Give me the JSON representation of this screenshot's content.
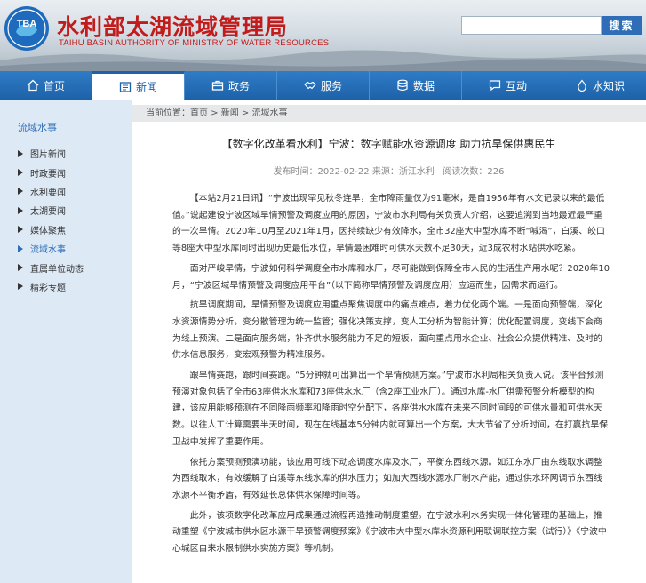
{
  "header": {
    "logo_text": "TBA",
    "title": "水利部太湖流域管理局",
    "subtitle": "TAIHU BASIN AUTHORITY OF MINISTRY OF WATER RESOURCES",
    "search": {
      "placeholder": "",
      "button_label": "搜索"
    }
  },
  "nav": {
    "items": [
      {
        "label": "首页",
        "icon": "home-icon"
      },
      {
        "label": "新闻",
        "icon": "news-icon"
      },
      {
        "label": "政务",
        "icon": "briefcase-icon"
      },
      {
        "label": "服务",
        "icon": "handshake-icon"
      },
      {
        "label": "数据",
        "icon": "database-icon"
      },
      {
        "label": "互动",
        "icon": "chat-icon"
      },
      {
        "label": "水知识",
        "icon": "water-drop-icon"
      }
    ],
    "active_index": 1
  },
  "sidebar": {
    "title": "流域水事",
    "items": [
      {
        "label": "图片新闻"
      },
      {
        "label": "时政要闻"
      },
      {
        "label": "水利要闻"
      },
      {
        "label": "太湖要闻"
      },
      {
        "label": "媒体聚焦"
      },
      {
        "label": "流域水事"
      },
      {
        "label": "直属单位动态"
      },
      {
        "label": "精彩专题"
      }
    ],
    "active_index": 5
  },
  "breadcrumb": {
    "prefix": "当前位置：",
    "items": [
      "首页",
      "新闻",
      "流域水事"
    ],
    "separator": " > "
  },
  "article": {
    "title": "【数字化改革看水利】宁波：数字赋能水资源调度 助力抗旱保供惠民生",
    "meta": {
      "published_label": "发布时间：",
      "published": "2022-02-22",
      "source_label": "来源：",
      "source": "浙江水利",
      "views_label": "阅读次数：",
      "views": "226"
    },
    "paragraphs": [
      "【本站2月21日讯】“宁波出现罕见秋冬连旱，全市降雨量仅为91毫米，是自1956年有水文记录以来的最低值。”说起建设宁波区域旱情预警及调度应用的原因，宁波市水利局有关负责人介绍，这要追溯到当地最近最严重的一次旱情。2020年10月至2021年1月，因持续缺少有效降水，全市32座大中型水库不断“喊渴”，白溪、皎口等8座大中型水库同时出现历史最低水位，旱情最困难时可供水天数不足30天，近3成农村水站供水吃紧。",
      "面对严峻旱情，宁波如何科学调度全市水库和水厂，尽可能做到保障全市人民的生活生产用水呢？2020年10月，“宁波区域旱情预警及调度应用平台”（以下简称旱情预警及调度应用）应运而生，因需求而运行。",
      "抗旱调度期间，旱情预警及调度应用重点聚焦调度中的痛点难点，着力优化两个端。一是面向预警端，深化水资源情势分析，变分散管理为统一监管；强化决策支撑，变人工分析为智能计算；优化配置调度，变线下会商为线上预演。二是面向服务端，补齐供水服务能力不足的短板，面向重点用水企业、社会公众提供精准、及时的供水信息服务，变宏观预警为精准服务。",
      "跟旱情赛跑，跟时间赛跑。“5分钟就可出算出一个旱情预测方案。”宁波市水利局相关负责人说。该平台预测预演对象包括了全市63座供水水库和73座供水水厂（含2座工业水厂）。通过水库-水厂供需预警分析模型的构建，该应用能够预测在不同降雨频率和降雨时空分配下，各座供水水库在未来不同时间段的可供水量和可供水天数。以往人工计算需要半天时间，现在在线基本5分钟内就可算出一个方案，大大节省了分析时间，在打赢抗旱保卫战中发挥了重要作用。",
      "依托方案预测预演功能，该应用可线下动态调度水库及水厂，平衡东西线水源。如江东水厂由东线取水调整为西线取水，有效缓解了白溪等东线水库的供水压力；如加大西线水源水厂制水产能，通过供水环网调节东西线水源不平衡矛盾，有效延长总体供水保障时间等。",
      "此外，该项数字化改革应用成果通过流程再造推动制度重塑。在宁波水利水务实现一体化管理的基础上，推动重塑《宁波城市供水区水源干旱预警调度预案》《宁波市大中型水库水资源利用联调联控方案（试行）》《宁波中心城区自来水限制供水实施方案》等机制。"
    ]
  }
}
